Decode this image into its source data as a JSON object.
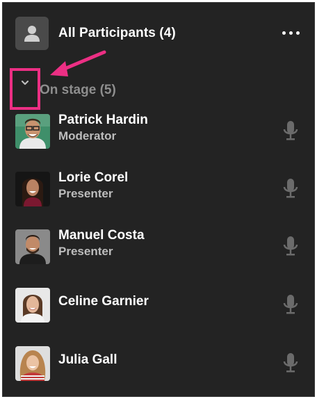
{
  "header": {
    "title": "All Participants (4)",
    "icon": "person-icon",
    "more_icon": "more-horizontal-icon"
  },
  "section": {
    "label": "On stage (5)",
    "toggle_icon": "chevron-down-icon",
    "highlight_color": "#ec2f84"
  },
  "participants": [
    {
      "name": "Patrick Hardin",
      "role": "Moderator",
      "mic_icon": "microphone-icon"
    },
    {
      "name": "Lorie Corel",
      "role": "Presenter",
      "mic_icon": "microphone-icon"
    },
    {
      "name": "Manuel Costa",
      "role": "Presenter",
      "mic_icon": "microphone-icon"
    },
    {
      "name": "Celine Garnier",
      "role": "",
      "mic_icon": "microphone-icon"
    },
    {
      "name": "Julia Gall",
      "role": "",
      "mic_icon": "microphone-icon"
    }
  ],
  "colors": {
    "panel_bg": "#232323",
    "text_primary": "#ffffff",
    "text_secondary": "#bdbdbd",
    "mic": "#6b6b6b",
    "accent": "#ec2f84"
  }
}
